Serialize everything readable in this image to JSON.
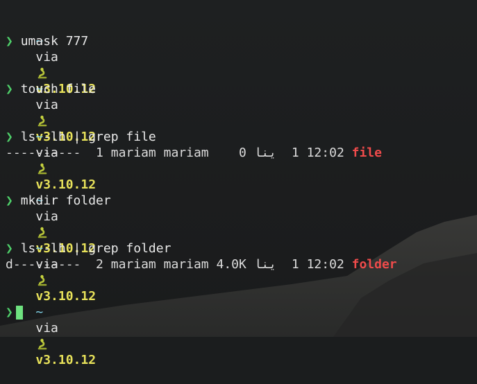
{
  "prompt": {
    "tilde": "~",
    "via": "via",
    "snake_icon": "python-snake-icon",
    "version": "v3.10.12",
    "symbol": "❯"
  },
  "commands": [
    {
      "cmd": "umask 777"
    },
    {
      "cmd": "touch file"
    },
    {
      "cmd": "ls -lh | grep file",
      "output": {
        "perms": "----------",
        "links": " 1",
        "owner": "mariam",
        "group": "mariam",
        "size": "   0",
        "month": "ينا",
        "day": " 1",
        "time": "12:02",
        "name": "file"
      }
    },
    {
      "cmd": "mkdir folder"
    },
    {
      "cmd": "ls -lh | grep folder",
      "output": {
        "perms": "d---------",
        "links": " 2",
        "owner": "mariam",
        "group": "mariam",
        "size": "4.0K",
        "month": "ينا",
        "day": " 1",
        "time": "12:02",
        "name": "folder"
      }
    }
  ],
  "colors": {
    "background": "#1b1d1e",
    "tilde": "#7fd1e6",
    "version": "#e8e25a",
    "prompt_symbol": "#4fd06a",
    "filename": "#ef4b4b",
    "cursor": "#6ee27f"
  }
}
